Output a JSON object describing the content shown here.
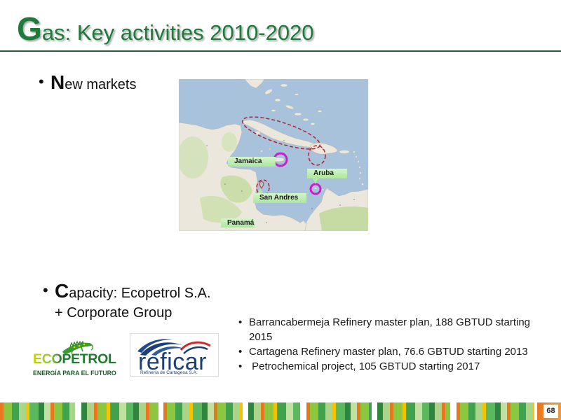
{
  "slide": {
    "title_initial": "G",
    "title_rest": "as: Key activities 2010-2020",
    "page_number": "68"
  },
  "new_markets": {
    "initial": "N",
    "rest": "ew markets"
  },
  "capacity": {
    "initial": "C",
    "rest": "apacity: Ecopetrol S.A.",
    "line2": "+ Corporate Group"
  },
  "map": {
    "labels": {
      "jamaica": "Jamaica",
      "aruba": "Aruba",
      "san_andres": "San Andres",
      "panama": "Panamá"
    }
  },
  "projects": [
    "Barrancabermeja Refinery master plan, 188 GBTUD starting 2015",
    "Cartagena Refinery master plan, 76.6 GBTUD starting 2013",
    " Petrochemical project, 105 GBTUD starting 2017"
  ],
  "logos": {
    "ecopetrol": {
      "name": "ECOPETROL",
      "tagline": "ENERGÍA PARA EL FUTURO"
    },
    "reficar": {
      "name": "reficar",
      "tagline": "Refinería de Cartagena S.A."
    }
  },
  "colors": {
    "title_green": "#1e7b3c",
    "divider": "#2d5b3d",
    "region_outline_red": "#b3232b",
    "highlight_ring_magenta": "#c81fc8",
    "map_label_green": "#b2e8a4"
  }
}
